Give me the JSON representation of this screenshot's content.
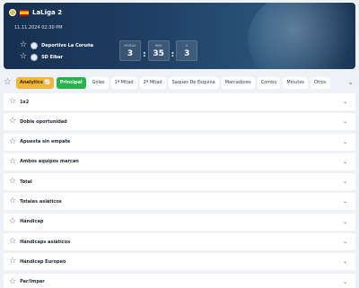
{
  "match": {
    "league": "LaLiga 2",
    "datetime": "11.11.2024 02:30 PM",
    "home_team": "Deportivo La Coruña",
    "away_team": "SD Eibar",
    "timer": {
      "hours_label": "HORAS",
      "hours": "3",
      "minutes_label": "MIN",
      "minutes": "35",
      "seconds_label": "S",
      "seconds": "3"
    }
  },
  "tabs": [
    {
      "label": "Analytics"
    },
    {
      "label": "Principal"
    },
    {
      "label": "Goles"
    },
    {
      "label": "1ª Mitad"
    },
    {
      "label": "2ª Mitad"
    },
    {
      "label": "Saques De Esquina"
    },
    {
      "label": "Marcadores"
    },
    {
      "label": "Combo"
    },
    {
      "label": "Minutos"
    },
    {
      "label": "Otros"
    }
  ],
  "markets": [
    {
      "label": "1x2"
    },
    {
      "label": "Doble oportunidad"
    },
    {
      "label": "Apuesta sin empate"
    },
    {
      "label": "Ambos equipos marcan"
    },
    {
      "label": "Total"
    },
    {
      "label": "Totales asiáticos"
    },
    {
      "label": "Hándicap"
    },
    {
      "label": "Hándicaps asiáticos"
    },
    {
      "label": "Hándicap Europeo"
    },
    {
      "label": "Par/Impar"
    }
  ],
  "colors": {
    "analytics": "#f0b73b",
    "active_tab": "#27b34e",
    "hero": "#1f3e63"
  }
}
